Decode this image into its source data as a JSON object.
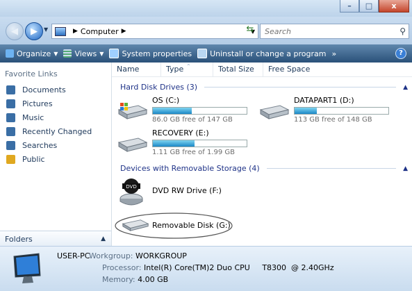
{
  "window": {
    "buttons": {
      "minimize": "–",
      "maximize": "□",
      "close": "x"
    }
  },
  "address": {
    "location": "Computer",
    "search_placeholder": "Search"
  },
  "toolbar": {
    "organize": "Organize",
    "views": "Views",
    "system_properties": "System properties",
    "uninstall": "Uninstall or change a program",
    "more": "»"
  },
  "sidebar": {
    "heading": "Favorite Links",
    "items": [
      {
        "label": "Documents",
        "color": "#3a6ea5"
      },
      {
        "label": "Pictures",
        "color": "#3a6ea5"
      },
      {
        "label": "Music",
        "color": "#3a6ea5"
      },
      {
        "label": "Recently Changed",
        "color": "#3a6ea5"
      },
      {
        "label": "Searches",
        "color": "#3a6ea5"
      },
      {
        "label": "Public",
        "color": "#e0a820"
      }
    ],
    "folders_label": "Folders"
  },
  "columns": [
    "Name",
    "Type",
    "Total Size",
    "Free Space"
  ],
  "groups": {
    "hard_disks": {
      "title": "Hard Disk Drives (3)",
      "drives": [
        {
          "name": "OS (C:)",
          "free_text": "86.0 GB free of 147 GB",
          "used_fraction": 0.415
        },
        {
          "name": "DATAPART1 (D:)",
          "free_text": "113 GB free of 148 GB",
          "used_fraction": 0.236
        },
        {
          "name": "RECOVERY (E:)",
          "free_text": "1.11 GB free of 1.99 GB",
          "used_fraction": 0.442
        }
      ]
    },
    "removable": {
      "title": "Devices with Removable Storage (4)",
      "devices": [
        {
          "name": "DVD RW Drive (F:)",
          "icon_label": "DVD"
        },
        {
          "name": "Removable Disk (G:)"
        }
      ]
    }
  },
  "details": {
    "pc_name": "USER-PC",
    "workgroup_label": "Workgroup:",
    "workgroup": "WORKGROUP",
    "processor_label": "Processor:",
    "processor": "Intel(R) Core(TM)2 Duo CPU     T8300  @ 2.40GHz",
    "memory_label": "Memory:",
    "memory": "4.00 GB"
  }
}
